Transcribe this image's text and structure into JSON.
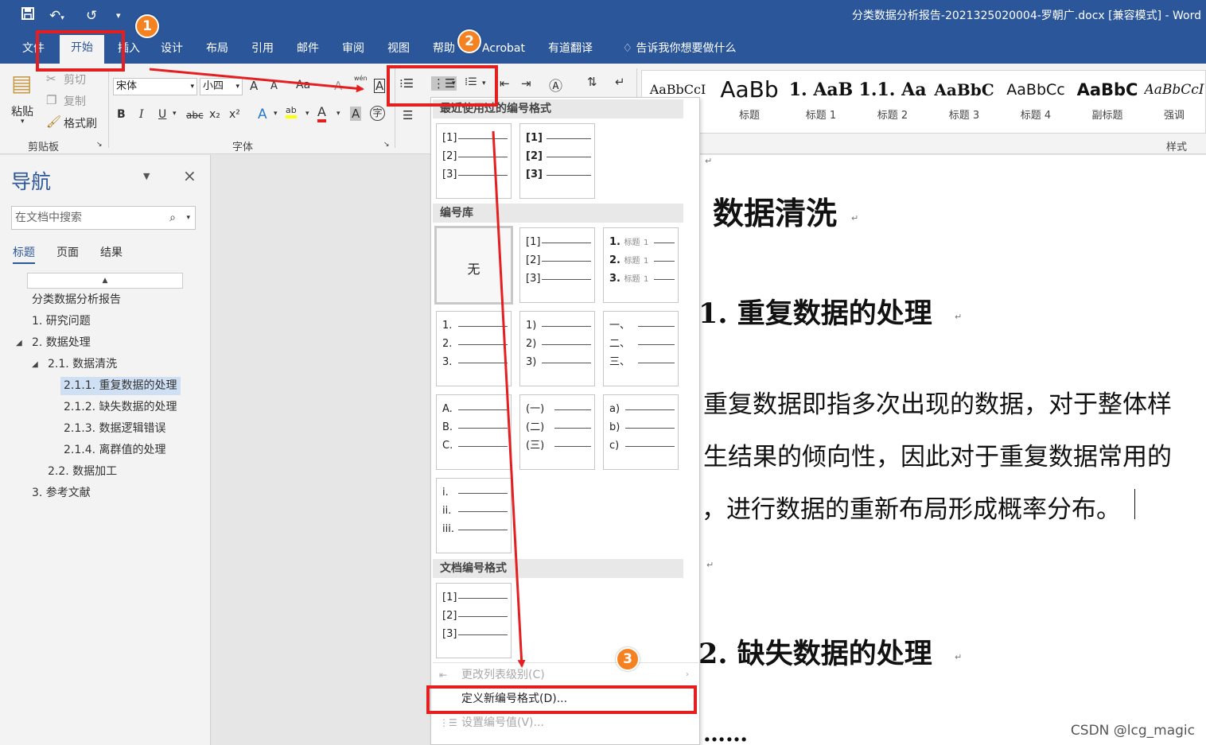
{
  "window": {
    "title": "分类数据分析报告-2021325020004-罗朝广.docx [兼容模式]  -  Word"
  },
  "ribbon_tabs": [
    "文件",
    "开始",
    "插入",
    "设计",
    "布局",
    "引用",
    "邮件",
    "审阅",
    "视图",
    "帮助",
    "Acrobat",
    "有道翻译"
  ],
  "tell_me": "告诉我你想要做什么",
  "clipboard": {
    "paste": "粘贴",
    "cut": "剪切",
    "copy": "复制",
    "format_painter": "格式刷",
    "label": "剪贴板"
  },
  "font": {
    "name": "宋体",
    "size": "小四",
    "label": "字体",
    "bold": "B",
    "italic": "I",
    "underline": "U",
    "strike": "abc",
    "subscript": "x₂",
    "superscript": "x²",
    "grow": "A",
    "shrink": "A",
    "case": "Aa",
    "clear": "A",
    "effects": "A",
    "highlight": "ab",
    "color": "A",
    "shade": "A",
    "phonetic": "wén",
    "border_char": "A",
    "enclose": "字"
  },
  "styles": {
    "label": "样式",
    "items": [
      {
        "preview": "AaBbCcI",
        "name": ""
      },
      {
        "preview": "AaBb",
        "name": "标题"
      },
      {
        "preview": "1. AaB",
        "name": "标题 1"
      },
      {
        "preview": "1.1. Aa",
        "name": "标题 2"
      },
      {
        "preview": "AaBbC",
        "name": "标题 3"
      },
      {
        "preview": "AaBbCc",
        "name": "标题 4"
      },
      {
        "preview": "AaBbC",
        "name": "副标题"
      },
      {
        "preview": "AaBbCcI",
        "name": "强调"
      }
    ]
  },
  "navigation": {
    "title": "导航",
    "search_placeholder": "在文档中搜索",
    "tabs": [
      "标题",
      "页面",
      "结果"
    ],
    "items": [
      {
        "text": "分类数据分析报告"
      },
      {
        "text": "1. 研究问题"
      },
      {
        "text": "2. 数据处理"
      },
      {
        "text": "2.1. 数据清洗"
      },
      {
        "text": "2.1.1. 重复数据的处理"
      },
      {
        "text": "2.1.2. 缺失数据的处理"
      },
      {
        "text": "2.1.3. 数据逻辑错误"
      },
      {
        "text": "2.1.4. 离群值的处理"
      },
      {
        "text": "2.2. 数据加工"
      },
      {
        "text": "3. 参考文献"
      }
    ]
  },
  "document": {
    "heading_main": "数据清洗",
    "heading_1": "1. 重复数据的处理",
    "para_1": "重复数据即指多次出现的数据，对于整体样",
    "para_2": "生结果的倾向性，因此对于重复数据常用的",
    "para_3": "，进行数据的重新布局形成概率分布。",
    "heading_2": "2. 缺失数据的处理",
    "ellipsis": "……",
    "para_mark": "↵"
  },
  "numbering_menu": {
    "recent_label": "最近使用过的编号格式",
    "library_label": "编号库",
    "doc_label": "文档编号格式",
    "none_label": "无",
    "recent": [
      [
        "[1]",
        "[2]",
        "[3]"
      ],
      [
        "[1]",
        "[2]",
        "[3]"
      ]
    ],
    "library": [
      [
        "[1]",
        "[2]",
        "[3]"
      ],
      [
        "1.",
        "2.",
        "3."
      ],
      [
        "1.",
        "2.",
        "3."
      ],
      [
        "1)",
        "2)",
        "3)"
      ],
      [
        "一、",
        "二、",
        "三、"
      ],
      [
        "A.",
        "B.",
        "C."
      ],
      [
        "(一)",
        "(二)",
        "(三)"
      ],
      [
        "a)",
        "b)",
        "c)"
      ],
      [
        "i.",
        "ii.",
        "iii."
      ]
    ],
    "heading_level_label": "标题",
    "heading_level_num": "1",
    "doc_formats": [
      [
        "[1]",
        "[2]",
        "[3]"
      ]
    ],
    "change_level": "更改列表级别(C)",
    "define_new": "定义新编号格式(D)...",
    "set_value": "设置编号值(V)..."
  },
  "annotations": {
    "badge_1": "1",
    "badge_2": "2",
    "badge_3": "3",
    "accent": "#e51f1f",
    "badge_color": "#f58220"
  },
  "watermark": "CSDN @lcg_magic"
}
